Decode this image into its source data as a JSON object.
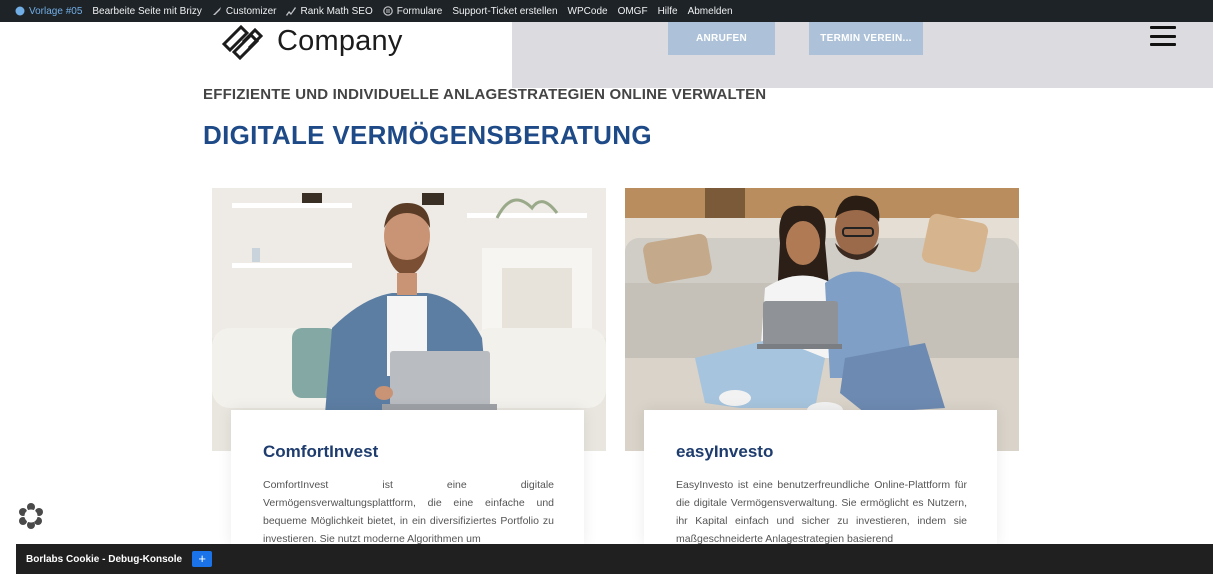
{
  "adminbar": {
    "items": [
      {
        "label": "Vorlage #05",
        "icon": "palette-icon"
      },
      {
        "label": "Bearbeite Seite mit Brizy",
        "icon": ""
      },
      {
        "label": "Customizer",
        "icon": "brush-icon"
      },
      {
        "label": "Rank Math SEO",
        "icon": "chart-icon"
      },
      {
        "label": "Formulare",
        "icon": "forms-icon"
      },
      {
        "label": "Support-Ticket erstellen",
        "icon": ""
      },
      {
        "label": "WPCode",
        "icon": ""
      },
      {
        "label": "OMGF",
        "icon": ""
      },
      {
        "label": "Hilfe",
        "icon": ""
      },
      {
        "label": "Abmelden",
        "icon": ""
      }
    ]
  },
  "header": {
    "logo_text": "Company",
    "call_button": "ANRUFEN",
    "appointment_button": "TERMIN VEREIN..."
  },
  "hero": {
    "eyebrow": "EFFIZIENTE UND INDIVIDUELLE ANLAGESTRATEGIEN ONLINE VERWALTEN",
    "title": "DIGITALE VERMÖGENSBERATUNG"
  },
  "cards": [
    {
      "title": "ComfortInvest",
      "text": "ComfortInvest ist eine digitale Vermögensverwaltungsplattform, die eine einfache und bequeme Möglichkeit bietet, in ein diversifiziertes Portfolio zu investieren. Sie nutzt moderne Algorithmen um"
    },
    {
      "title": "easyInvesto",
      "text": "EasyInvesto ist eine benutzerfreundliche Online-Plattform für die digitale Vermögensverwaltung. Sie ermöglicht es Nutzern, ihr Kapital einfach und sicher zu investieren, indem sie maßgeschneiderte Anlagestrategien basierend"
    }
  ],
  "debug": {
    "title": "Borlabs Cookie - Debug-Konsole",
    "toggle": "+"
  },
  "colors": {
    "accent": "#1e4a87",
    "button": "#adc2d8",
    "adminbar": "#1d2327"
  }
}
